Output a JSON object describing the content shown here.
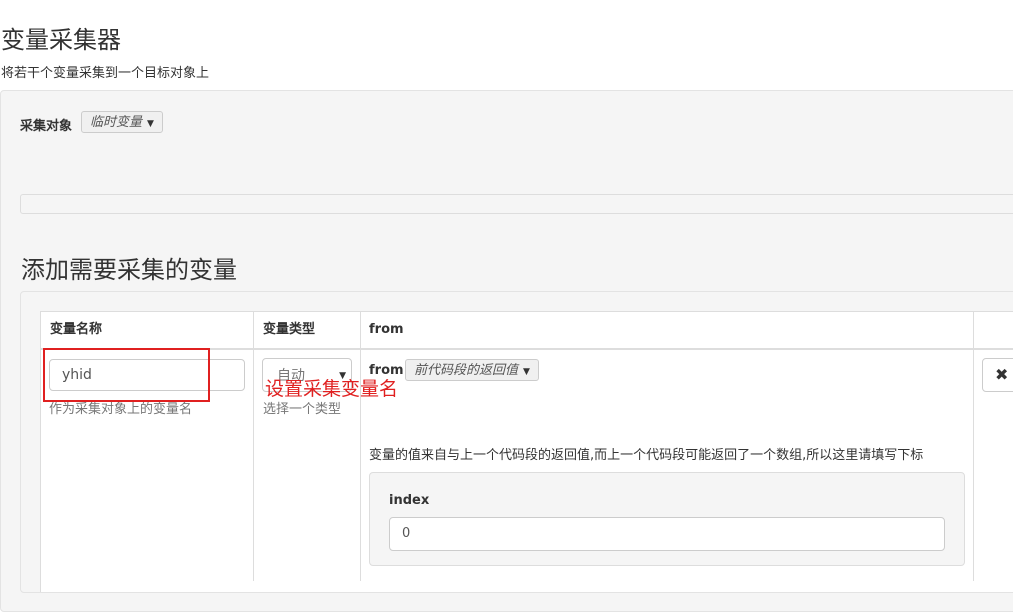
{
  "header": {
    "title": "变量采集器",
    "subtitle": "将若干个变量采集到一个目标对象上"
  },
  "target": {
    "label": "采集对象",
    "value": "临时变量"
  },
  "section": {
    "title": "添加需要采集的变量"
  },
  "table": {
    "headers": [
      "变量名称",
      "变量类型",
      "from"
    ],
    "row": {
      "name_value": "yhid",
      "name_help": "作为采集对象上的变量名",
      "type_value": "自动",
      "type_help": "选择一个类型",
      "from_label": "from",
      "from_value": "前代码段的返回值",
      "description": "变量的值来自与上一个代码段的返回值,而上一个代码段可能返回了一个数组,所以这里请填写下标",
      "index_label": "index",
      "index_value": "0",
      "remove_icon": "close-icon"
    }
  },
  "annotation": {
    "text": "设置采集变量名",
    "color": "#e02020"
  }
}
